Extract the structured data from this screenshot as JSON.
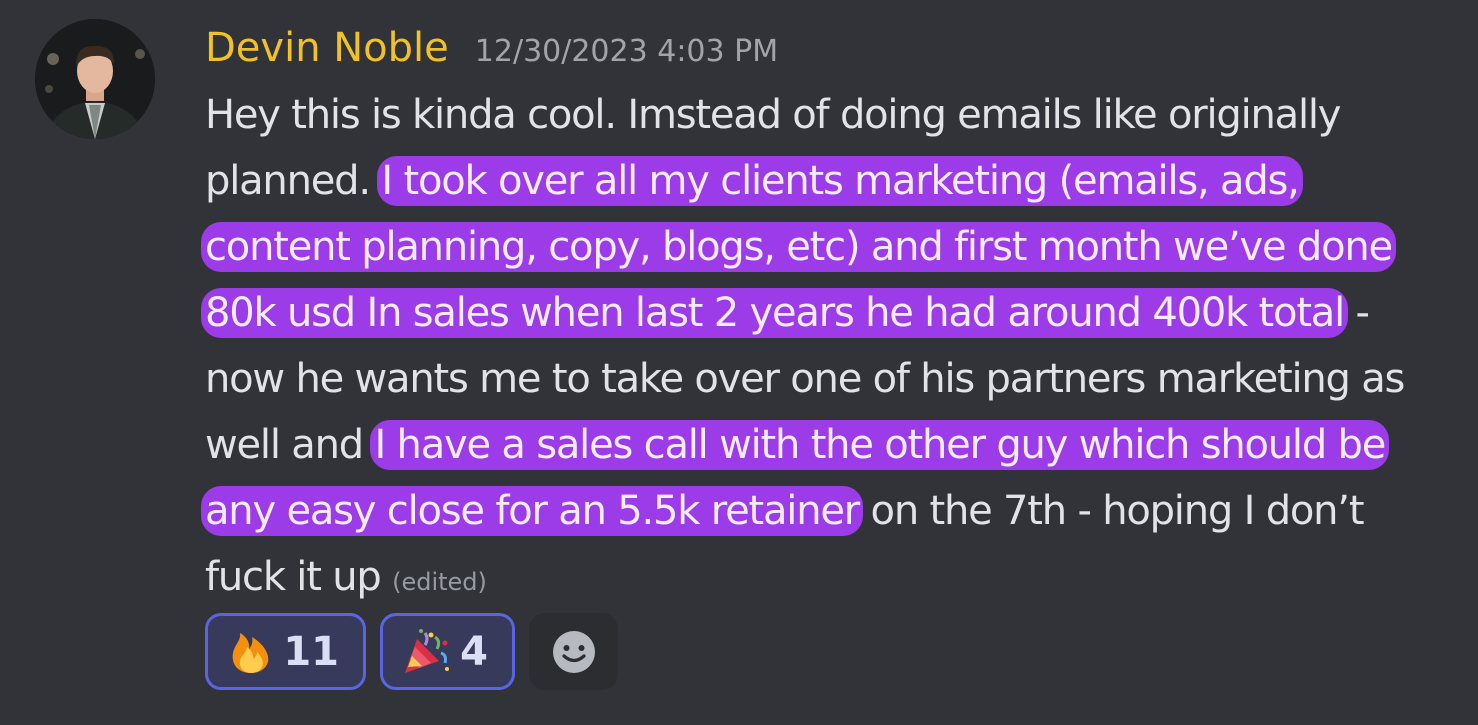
{
  "message": {
    "author": "Devin Noble",
    "timestamp": "12/30/2023 4:03 PM",
    "segments": [
      {
        "text": "Hey this is kinda cool. Imstead of doing emails like originally planned. ",
        "highlighted": false
      },
      {
        "text": "I took over all my clients marketing (emails, ads, content planning, copy, blogs, etc) and first month we’ve done 80k usd In sales when last 2 years he had around 400k total",
        "highlighted": true
      },
      {
        "text": " - now he wants me to take over one of his partners marketing as well and ",
        "highlighted": false
      },
      {
        "text": "I have a sales call with the other guy which should be any easy close for an 5.5k retainer",
        "highlighted": true
      },
      {
        "text": " on the 7th - hoping I don’t fuck it up ",
        "highlighted": false
      }
    ],
    "edited_label": "(edited)"
  },
  "reactions": [
    {
      "emoji": "fire-emoji",
      "count": "11",
      "reacted_by_me": true
    },
    {
      "emoji": "party-popper-emoji",
      "count": "4",
      "reacted_by_me": true
    }
  ],
  "add_reaction_icon": "smiley-add-reaction-icon",
  "colors": {
    "background": "#313338",
    "username": "#f0c228",
    "highlight": "#9c3be8",
    "reaction_border": "#5966df",
    "reaction_bg": "#373a5a"
  }
}
